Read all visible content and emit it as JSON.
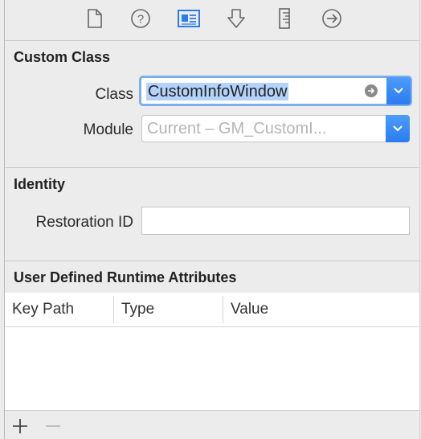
{
  "toolbar": {
    "tabs": [
      {
        "icon": "file-icon"
      },
      {
        "icon": "help-icon"
      },
      {
        "icon": "identity-inspector-icon",
        "selected": true
      },
      {
        "icon": "attributes-inspector-icon"
      },
      {
        "icon": "size-inspector-icon"
      },
      {
        "icon": "connections-inspector-icon"
      }
    ],
    "accent_color": "#2a7cf0"
  },
  "custom_class": {
    "title": "Custom Class",
    "class_label": "Class",
    "class_value": "CustomInfoWindow",
    "module_label": "Module",
    "module_placeholder": "Current – GM_CustomI..."
  },
  "identity": {
    "title": "Identity",
    "restoration_label": "Restoration ID",
    "restoration_value": ""
  },
  "runtime_attributes": {
    "title": "User Defined Runtime Attributes",
    "columns": [
      "Key Path",
      "Type",
      "Value"
    ],
    "rows": []
  },
  "footer": {
    "add_symbol": "+",
    "remove_symbol": "−"
  }
}
